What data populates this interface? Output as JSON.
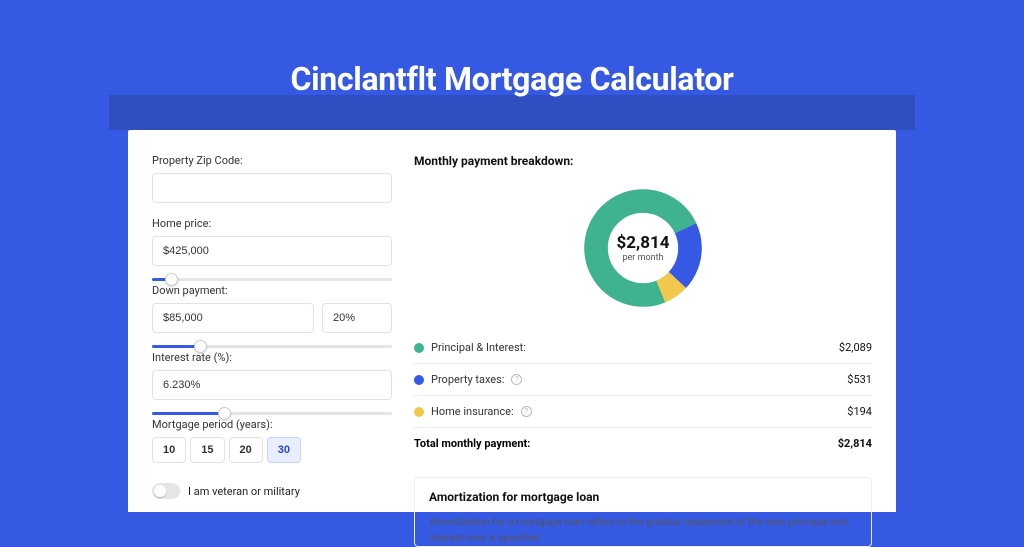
{
  "title": "Cinclantflt Mortgage Calculator",
  "form": {
    "zip_label": "Property Zip Code:",
    "zip_value": "",
    "home_price_label": "Home price:",
    "home_price_value": "$425,000",
    "home_price_slider_pct": 8,
    "down_payment_label": "Down payment:",
    "down_payment_value": "$85,000",
    "down_payment_pct": "20%",
    "down_payment_slider_pct": 20,
    "interest_label": "Interest rate (%):",
    "interest_value": "6.230%",
    "interest_slider_pct": 30,
    "period_label": "Mortgage period (years):",
    "period_options": [
      "10",
      "15",
      "20",
      "30"
    ],
    "period_selected": "30",
    "veteran_label": "I am veteran or military",
    "veteran_on": false
  },
  "breakdown": {
    "title": "Monthly payment breakdown:",
    "center_amount": "$2,814",
    "center_sub": "per month",
    "items": [
      {
        "label": "Principal & Interest:",
        "value": "$2,089",
        "color": "#3fb28f",
        "has_info": false
      },
      {
        "label": "Property taxes:",
        "value": "$531",
        "color": "#3659e3",
        "has_info": true
      },
      {
        "label": "Home insurance:",
        "value": "$194",
        "color": "#f1c84c",
        "has_info": true
      }
    ],
    "total_label": "Total monthly payment:",
    "total_value": "$2,814"
  },
  "amortization": {
    "title": "Amortization for mortgage loan",
    "body": "Amortization for a mortgage loan refers to the gradual repayment of the loan principal and interest over a specified"
  },
  "chart_data": {
    "type": "pie",
    "title": "Monthly payment breakdown",
    "series": [
      {
        "name": "Principal & Interest",
        "value": 2089,
        "color": "#3fb28f"
      },
      {
        "name": "Property taxes",
        "value": 531,
        "color": "#3659e3"
      },
      {
        "name": "Home insurance",
        "value": 194,
        "color": "#f1c84c"
      }
    ],
    "total": 2814,
    "unit": "USD per month"
  }
}
